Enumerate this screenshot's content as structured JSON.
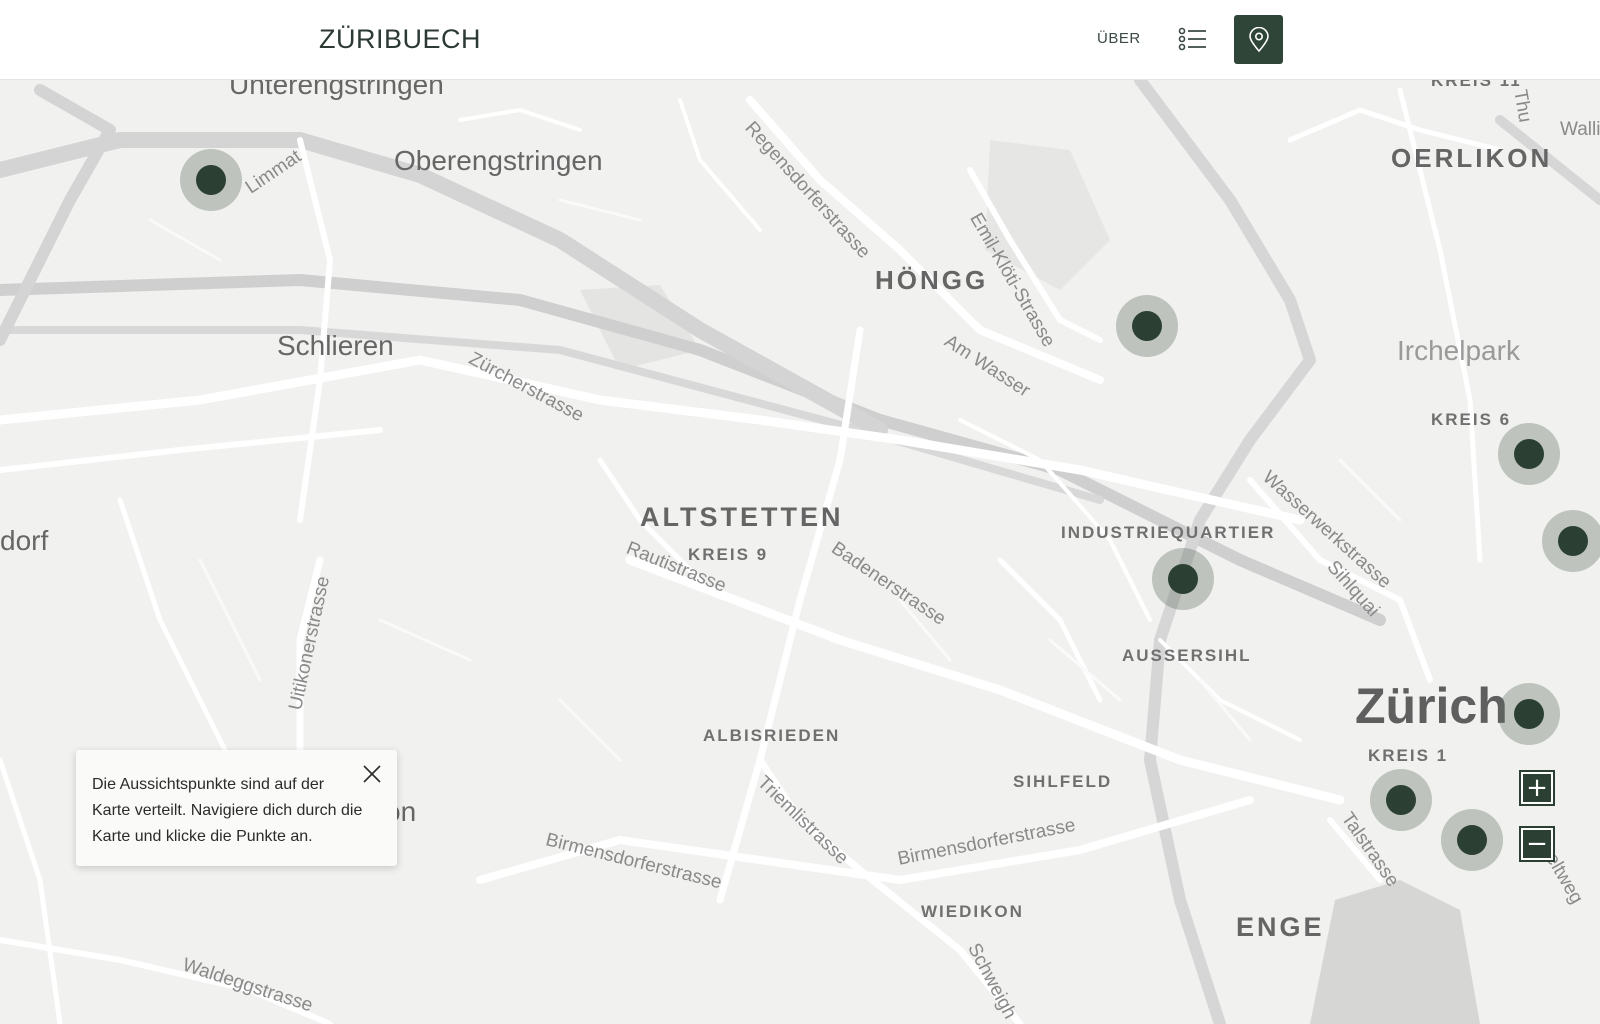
{
  "header": {
    "logo": "ZÜRIBUECH",
    "about_label": "ÜBER",
    "list_icon": "list-icon",
    "map_icon": "map-pin-icon"
  },
  "colors": {
    "accent": "#2e4538",
    "marker": "#2b4033",
    "map_bg": "#f1f1ef"
  },
  "map": {
    "towns": {
      "unterengstringen": "Unterengstringen",
      "oberengstringen": "Oberengstringen",
      "schlieren": "Schlieren",
      "dorf": "dorf",
      "irchelpark": "Irchelpark",
      "zurich": "Zürich",
      "on": "on"
    },
    "districts": {
      "hongg": "HÖNGG",
      "oerlikon": "OERLIKON",
      "altstetten": "ALTSTETTEN",
      "kreis9": "KREIS 9",
      "kreis6": "KREIS 6",
      "kreis11": "KREIS 11",
      "kreis1": "KREIS 1",
      "industriequartier": "INDUSTRIEQUARTIER",
      "aussersihl": "AUSSERSIHL",
      "albisrieden": "ALBISRIEDEN",
      "sihlfeld": "SIHLFELD",
      "wiedikon": "WIEDIKON",
      "enge": "ENGE"
    },
    "streets": {
      "limmat": "Limmat",
      "regensdorferstrasse": "Regensdorferstrasse",
      "emil_kloti": "Emil-Klöti-Strasse",
      "am_wasser": "Am Wasser",
      "zurcherstrasse": "Zürcherstrasse",
      "rautistrasse": "Rautistrasse",
      "badenerstrasse": "Badenerstrasse",
      "wasserwerkstrasse": "Wasserwerkstrasse",
      "sihlquai": "Sihlquai",
      "uitikonerstrasse": "Uitikonerstrasse",
      "triemlistrasse": "Triemlistrasse",
      "birmensdorferstrasse_w": "Birmensdorferstrasse",
      "birmensdorferstrasse_e": "Birmensdorferstrasse",
      "talstrasse": "Talstrasse",
      "schweighof": "Schweigh",
      "waldeggstrasse": "Waldeggstrasse",
      "thu": "Thu",
      "walli": "Walli",
      "zeltweg": "eltweg"
    }
  },
  "tooltip": {
    "text": "Die Aussichtspunkte sind auf der Karte verteilt. Navigiere dich durch die Karte und klicke die Punkte an."
  },
  "zoom": {
    "in_label": "+",
    "out_label": "−"
  },
  "markers_count": 9
}
